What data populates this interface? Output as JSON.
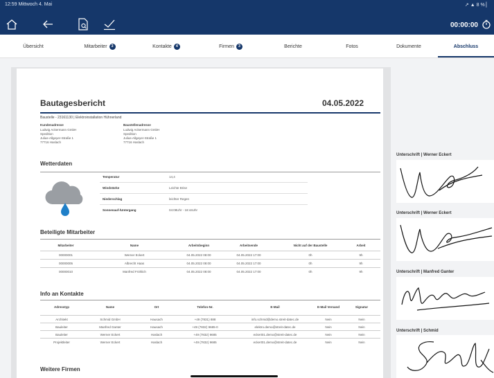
{
  "status_bar": {
    "time_date": "12:59  Mittwoch 4. Mai",
    "indicators": "↗ ▲ 8 % ▏"
  },
  "toolbar": {
    "icons": [
      "home-icon",
      "back-arrow-icon",
      "document-search-icon",
      "checkmark-icon"
    ],
    "timer": "00:00:00"
  },
  "tabs": [
    {
      "label": "Übersicht",
      "badge": ""
    },
    {
      "label": "Mitarbeiter",
      "badge": "3"
    },
    {
      "label": "Kontakte",
      "badge": "4"
    },
    {
      "label": "Firmen",
      "badge": "3"
    },
    {
      "label": "Berichte",
      "badge": ""
    },
    {
      "label": "Fotos",
      "badge": ""
    },
    {
      "label": "Dokumente",
      "badge": ""
    },
    {
      "label": "Abschluss",
      "badge": ""
    }
  ],
  "active_tab": "Abschluss",
  "report": {
    "title": "Bautagesbericht",
    "date": "04.05.2022",
    "subtitle": "Baustelle - 23161130 | Elektroinstallation Hühnerland",
    "customer_address": {
      "label": "Kundenadresse",
      "lines": [
        "Ludwig Ackermann GmbH",
        "Spedition",
        "Julius-Allgeyer-Straße 1",
        "77716 Haslach"
      ]
    },
    "site_address": {
      "label": "Baustellenadresse",
      "lines": [
        "Ludwig Ackermann GmbH",
        "Spedition",
        "Julius-Allgeyer-Straße 1",
        "77716 Haslach"
      ]
    },
    "weather": {
      "heading": "Wetterdaten",
      "rows": [
        {
          "label": "Temperatur",
          "value": "14,4"
        },
        {
          "label": "Windstärke",
          "value": "Leichte Brise"
        },
        {
          "label": "Niederschlag",
          "value": "leichter Regen"
        },
        {
          "label": "Sonnenauf-/Untergang",
          "value": "04:08Uhr - 18:44Uhr"
        }
      ]
    },
    "staff": {
      "heading": "Beteiligte Mitarbeiter",
      "columns": [
        "Mitarbeiter",
        "Name",
        "Arbeitsbeginn",
        "Arbeitsende",
        "Nicht auf der Baustelle",
        "Arbeit"
      ],
      "rows": [
        [
          "00000001",
          "Werner Eckert",
          "04.05.2022 08:00",
          "04.05.2022 17:00",
          "0h",
          "9h"
        ],
        [
          "00000005",
          "Albrecht Haas",
          "04.05.2022 08:00",
          "04.05.2022 17:00",
          "0h",
          "9h"
        ],
        [
          "00000010",
          "Manfred Fröhlich",
          "04.05.2022 08:00",
          "04.05.2022 17:00",
          "0h",
          "9h"
        ]
      ]
    },
    "contacts": {
      "heading": "Info an Kontakte",
      "columns": [
        "Adresstyp",
        "Name",
        "Ort",
        "Telefon-Nr.",
        "E-Mail",
        "E-Mail Versand",
        "Signatur"
      ],
      "rows": [
        [
          "Architekt",
          "Schmid GmbH",
          "Hausach",
          "+49 (7831) 888",
          "info.schmid@demo.streit-datec.de",
          "Nein",
          "Nein"
        ],
        [
          "Bauleiter",
          "Manfred Ganter",
          "Hausach",
          "+49 (7832) 9685-0",
          "elektro.demo@streit-datec.de",
          "Nein",
          "Nein"
        ],
        [
          "Bauleiter",
          "Werner Eckert",
          "Haslach",
          "+49 (7832) 9685",
          "eckert01.demo@streit-datec.de",
          "Nein",
          "Nein"
        ],
        [
          "Projektleiter",
          "Werner Eckert",
          "Haslach",
          "+49 (7832) 9685",
          "eckert01.demo@streit-datec.de",
          "Nein",
          "Nein"
        ]
      ]
    },
    "companies_heading": "Weitere Firmen"
  },
  "signatures": [
    {
      "label": "Unterschrift | Werner Eckert"
    },
    {
      "label": "Unterschrift | Werner Eckert"
    },
    {
      "label": "Unterschrift | Manfred Ganter"
    },
    {
      "label": "Unterschrift | Schmid"
    }
  ],
  "colors": {
    "header_bg": "#15376a",
    "accent": "#15376a",
    "weather_cloud": "#9a9ea3",
    "weather_drop": "#1f7fc8"
  }
}
